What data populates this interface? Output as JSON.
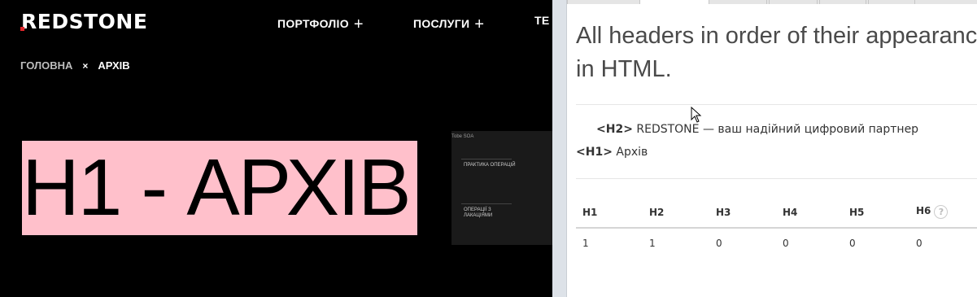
{
  "site": {
    "logo": "REDSTONE",
    "nav": [
      {
        "label": "ПОРТФОЛІО",
        "plus": "+"
      },
      {
        "label": "ПОСЛУГИ",
        "plus": "+"
      },
      {
        "label": "ТЕ",
        "plus": ""
      }
    ],
    "breadcrumb": {
      "home": "ГОЛОВНА",
      "separator": "×",
      "current": "АРХІВ"
    },
    "h1_highlight": "H1 - АРХІВ",
    "thumbnail": {
      "top": "Tobe    SOA",
      "item1": "ПРАКТИКА ОПЕРАЦІЙ",
      "item2": "ОПЕРАЦІЇ З ЛАКАЦІЯМИ"
    },
    "highlight_color": "#ffc0cb",
    "brand_accent": "#e0262a"
  },
  "panel": {
    "title_line1": "All headers in order of their appearance",
    "title_line2": "in HTML.",
    "headers": [
      {
        "tag": "<H2>",
        "text": " REDSTONE — ваш надійний цифровий партнер"
      },
      {
        "tag": "<H1>",
        "text": " Архів"
      }
    ],
    "table": {
      "columns": [
        "H1",
        "H2",
        "H3",
        "H4",
        "H5",
        "H6"
      ],
      "values": [
        "1",
        "1",
        "0",
        "0",
        "0",
        "0"
      ],
      "help_icon": "?"
    }
  }
}
